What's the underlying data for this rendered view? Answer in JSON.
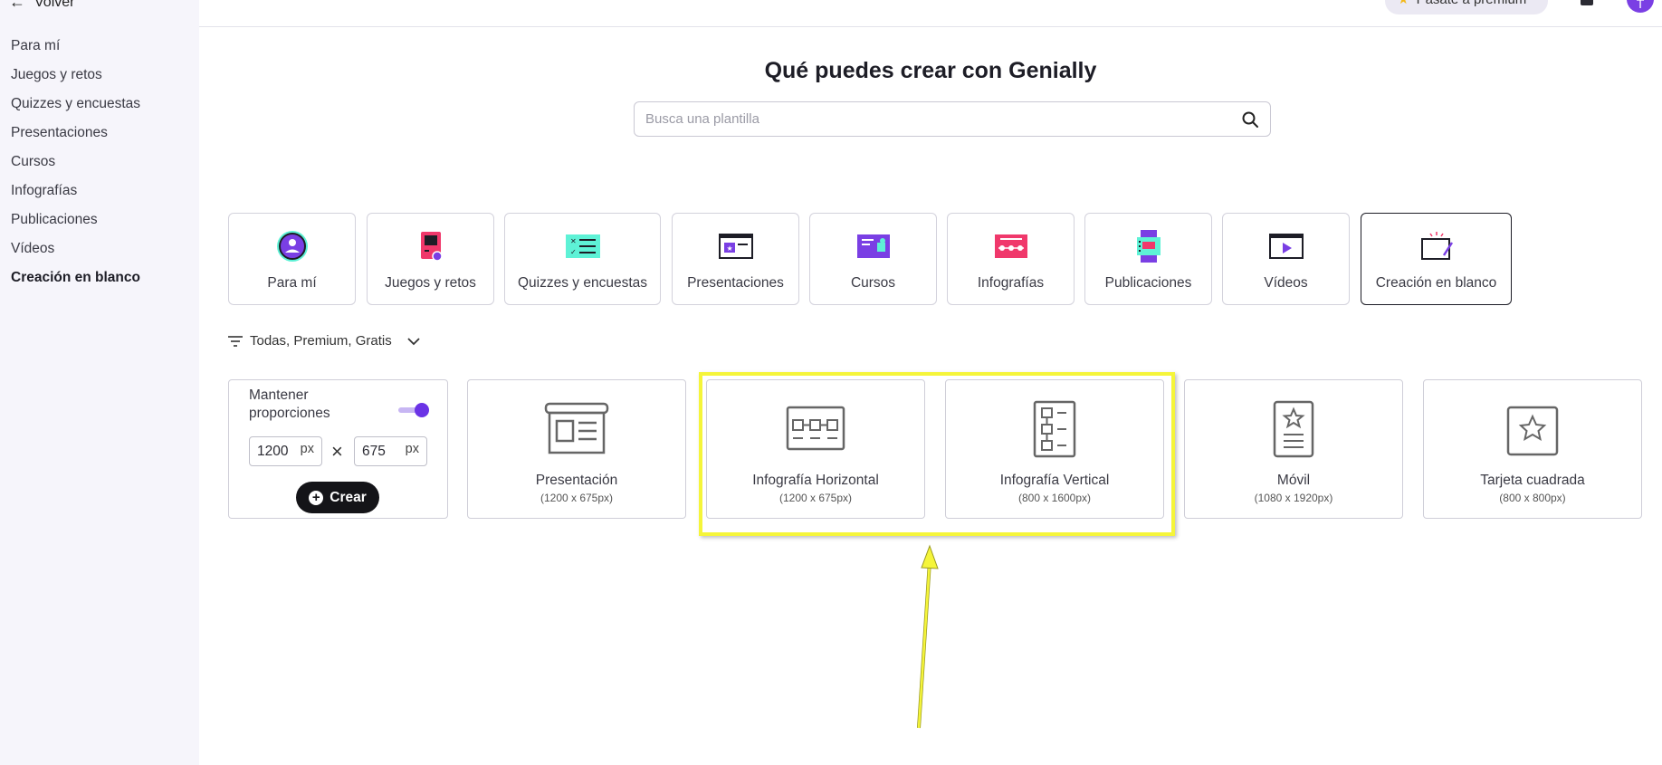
{
  "sidebar": {
    "back_label": "Volver",
    "items": [
      {
        "label": "Para mí"
      },
      {
        "label": "Juegos y retos"
      },
      {
        "label": "Quizzes y encuestas"
      },
      {
        "label": "Presentaciones"
      },
      {
        "label": "Cursos"
      },
      {
        "label": "Infografías"
      },
      {
        "label": "Publicaciones"
      },
      {
        "label": "Vídeos"
      },
      {
        "label": "Creación en blanco",
        "active": true
      }
    ]
  },
  "topbar": {
    "premium_label": "Pásate a premium",
    "avatar_initial": "T"
  },
  "header": {
    "title": "Qué puedes crear con Genially",
    "search_placeholder": "Busca una plantilla",
    "search_value": ""
  },
  "categories": [
    {
      "label": "Para mí",
      "icon": "user-circle-icon"
    },
    {
      "label": "Juegos y retos",
      "icon": "game-console-icon"
    },
    {
      "label": "Quizzes y encuestas",
      "icon": "quiz-list-icon"
    },
    {
      "label": "Presentaciones",
      "icon": "presentation-icon"
    },
    {
      "label": "Cursos",
      "icon": "course-icon"
    },
    {
      "label": "Infografías",
      "icon": "infographic-icon"
    },
    {
      "label": "Publicaciones",
      "icon": "publication-icon"
    },
    {
      "label": "Vídeos",
      "icon": "video-play-icon"
    },
    {
      "label": "Creación en blanco",
      "icon": "blank-canvas-icon",
      "selected": true
    }
  ],
  "filter": {
    "label": "Todas, Premium, Gratis"
  },
  "custom_size": {
    "keep_proportions_label": "Mantener proporciones",
    "keep_proportions": true,
    "width": "1200",
    "height": "675",
    "unit": "px",
    "create_label": "Crear"
  },
  "templates": [
    {
      "name": "Presentación",
      "size": "(1200 x 675px)",
      "icon": "presentation-layout-icon"
    },
    {
      "name": "Infografía Horizontal",
      "size": "(1200 x 675px)",
      "icon": "horizontal-infographic-icon"
    },
    {
      "name": "Infografía Vertical",
      "size": "(800 x 1600px)",
      "icon": "vertical-infographic-icon"
    },
    {
      "name": "Móvil",
      "size": "(1080 x 1920px)",
      "icon": "mobile-icon"
    },
    {
      "name": "Tarjeta cuadrada",
      "size": "(800 x 800px)",
      "icon": "square-card-icon"
    }
  ],
  "colors": {
    "accent": "#6b33e6",
    "highlight": "#f5f53a",
    "sidebar_bg": "#f6f5fb"
  }
}
